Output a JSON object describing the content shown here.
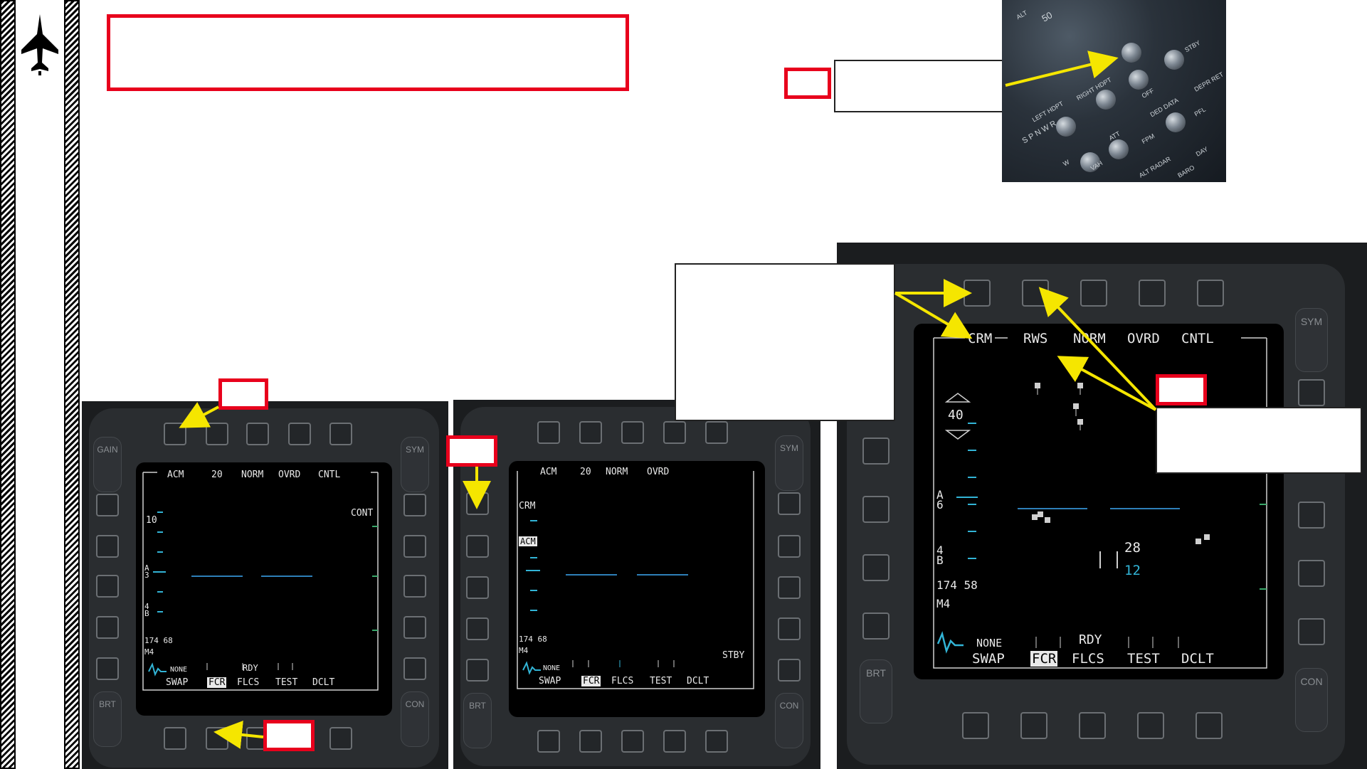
{
  "sidebar": {
    "logo_icon": "jet-aircraft-icon"
  },
  "colors": {
    "accent_red": "#e8001c",
    "arrow_yellow": "#f5e600",
    "scope_cyan": "#32b4d6"
  },
  "cockpit_photo": {
    "labels": [
      "ALT",
      "50",
      "RIGHT HDPT",
      "LEFT HDPT",
      "OFF",
      "STBY",
      "DED DATA",
      "PFL",
      "DEPR RET",
      "FPM",
      "ATT",
      "OFF",
      "DAY",
      "VAH",
      "W",
      "S P N W R",
      "OFF",
      "ALT RADAR",
      "BARO"
    ]
  },
  "mfd_left": {
    "top_labels": [
      "ACM",
      "20",
      "NORM",
      "OVRD",
      "CNTL"
    ],
    "cont_label": "CONT",
    "scale_value": "10",
    "a_value": "A\n3",
    "b_value": "4\nB",
    "speed": "174 68",
    "mode": "M4",
    "none_label": "NONE",
    "rdy_label": "RDY",
    "bottom_labels": [
      "SWAP",
      "FCR",
      "FLCS",
      "TEST",
      "DCLT"
    ],
    "rocker_labels": [
      "GAIN",
      "SYM",
      "BRT",
      "CON"
    ]
  },
  "mfd_mid": {
    "top_labels": [
      "ACM",
      "20",
      "NORM",
      "OVRD"
    ],
    "crm_label": "CRM",
    "acm_label": "ACM",
    "speed": "174 68",
    "mode": "M4",
    "stby_label": "STBY",
    "none_label": "NONE",
    "bottom_labels": [
      "SWAP",
      "FCR",
      "FLCS",
      "TEST",
      "DCLT"
    ],
    "rocker_labels": [
      "SYM",
      "BRT",
      "CON"
    ]
  },
  "mfd_right": {
    "top_labels": [
      "CRM",
      "RWS",
      "NORM",
      "OVRD",
      "CNTL"
    ],
    "range": "40",
    "a_value": "A\n6",
    "b_value": "4\nB",
    "speed": "174 58",
    "mode": "M4",
    "alt_top": "28",
    "alt_bottom": "12",
    "none_label": "NONE",
    "rdy_label": "RDY",
    "bottom_labels": [
      "SWAP",
      "FCR",
      "FLCS",
      "TEST",
      "DCLT"
    ],
    "rocker_labels": [
      "SYM",
      "BRT",
      "CON"
    ]
  }
}
